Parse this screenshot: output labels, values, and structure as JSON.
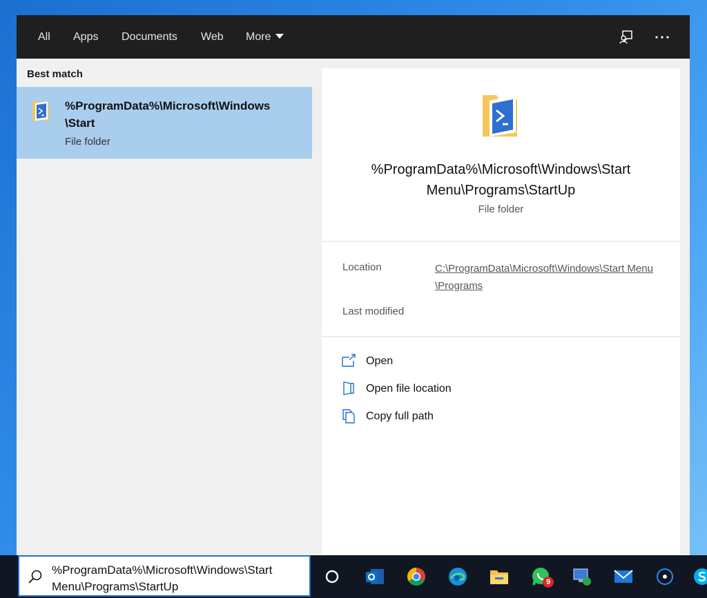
{
  "tabs": [
    {
      "label": "All"
    },
    {
      "label": "Apps"
    },
    {
      "label": "Documents"
    },
    {
      "label": "Web"
    },
    {
      "label": "More"
    }
  ],
  "topbar_icons": [
    "feedback-icon",
    "more-options-icon"
  ],
  "best_match": {
    "heading": "Best match",
    "title": "%ProgramData%\\Microsoft\\Windows\\Start",
    "subtitle": "File folder"
  },
  "detail": {
    "title": "%ProgramData%\\Microsoft\\Windows\\Start Menu\\Programs\\StartUp",
    "subtitle": "File folder",
    "location_label": "Location",
    "location_value": "C:\\ProgramData\\Microsoft\\Windows\\Start Menu\\Programs",
    "modified_label": "Last modified"
  },
  "actions": [
    {
      "label": "Open",
      "icon": "open-icon"
    },
    {
      "label": "Open file location",
      "icon": "file-location-icon"
    },
    {
      "label": "Copy full path",
      "icon": "copy-path-icon"
    }
  ],
  "search": {
    "value": "%ProgramData%\\Microsoft\\Windows\\Start Menu\\Programs\\StartUp"
  },
  "taskbar": {
    "whatsapp_badge": "9"
  },
  "colors": {
    "selected_row": "#a9cdec",
    "accent": "#1f6fd1",
    "topbar": "#1f1f1f"
  }
}
